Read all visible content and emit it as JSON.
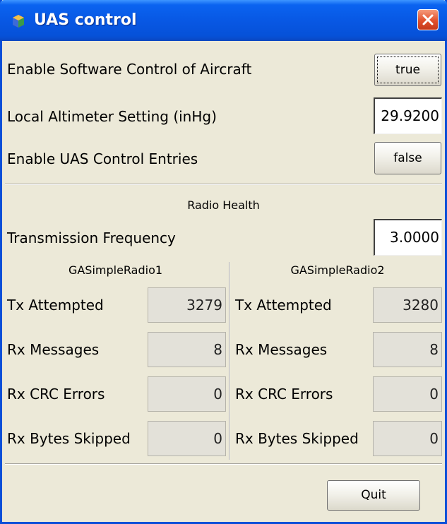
{
  "window": {
    "title": "UAS control",
    "icon": "app-icon",
    "close_icon": "close-icon"
  },
  "settings": {
    "software_control_label": "Enable Software Control of Aircraft",
    "software_control_value": "true",
    "altimeter_label": "Local Altimeter Setting (inHg)",
    "altimeter_value": "29.9200",
    "uas_entries_label": "Enable UAS Control Entries",
    "uas_entries_value": "false"
  },
  "radio_health": {
    "heading": "Radio Health",
    "frequency_label": "Transmission Frequency",
    "frequency_value": "3.0000",
    "radios": [
      {
        "name": "GASimpleRadio1",
        "tx_attempted_label": "Tx Attempted",
        "tx_attempted": "3279",
        "rx_messages_label": "Rx Messages",
        "rx_messages": "8",
        "rx_crc_errors_label": "Rx CRC Errors",
        "rx_crc_errors": "0",
        "rx_bytes_skipped_label": "Rx Bytes Skipped",
        "rx_bytes_skipped": "0"
      },
      {
        "name": "GASimpleRadio2",
        "tx_attempted_label": "Tx Attempted",
        "tx_attempted": "3280",
        "rx_messages_label": "Rx Messages",
        "rx_messages": "8",
        "rx_crc_errors_label": "Rx CRC Errors",
        "rx_crc_errors": "0",
        "rx_bytes_skipped_label": "Rx Bytes Skipped",
        "rx_bytes_skipped": "0"
      }
    ]
  },
  "footer": {
    "quit_label": "Quit"
  },
  "colors": {
    "titlebar": "#0858e4",
    "window_bg": "#ece9d8",
    "close_button": "#e1502c"
  }
}
